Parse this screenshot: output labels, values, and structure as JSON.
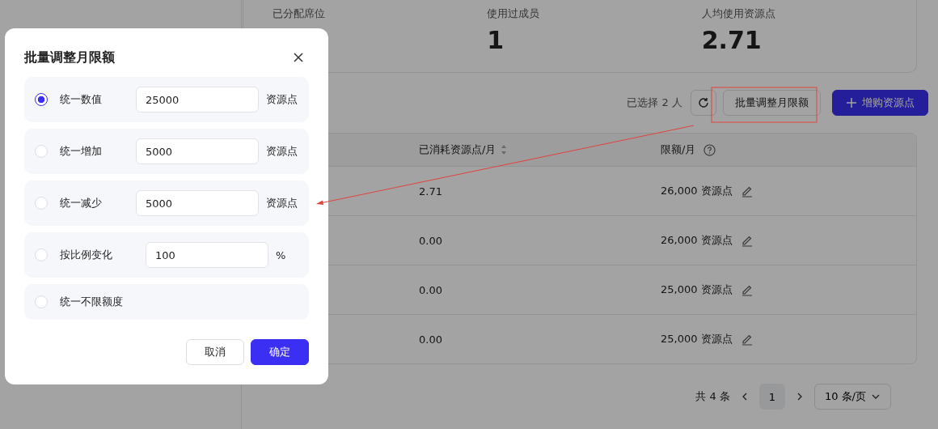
{
  "stats": [
    {
      "label": "已分配席位"
    },
    {
      "label": "使用过成员",
      "value": "1"
    },
    {
      "label": "人均使用资源点",
      "value": "2.71"
    }
  ],
  "toolbar": {
    "selection_text": "已选择 2 人",
    "batch_button": "批量调整月限额",
    "add_button": "增购资源点"
  },
  "table": {
    "columns": [
      "已消耗资源点/月",
      "限额/月"
    ],
    "rows": [
      {
        "consumed": "2.71",
        "limit": "26,000 资源点"
      },
      {
        "consumed": "0.00",
        "limit": "26,000 资源点"
      },
      {
        "consumed": "0.00",
        "limit": "25,000 资源点"
      },
      {
        "consumed": "0.00",
        "limit": "25,000 资源点"
      }
    ]
  },
  "pagination": {
    "total": "共 4 条",
    "page": "1",
    "page_size": "10 条/页"
  },
  "dialog": {
    "title": "批量调整月限额",
    "options": [
      {
        "label": "统一数值",
        "selected": true,
        "value": "25000",
        "unit": "资源点"
      },
      {
        "label": "统一增加",
        "selected": false,
        "value": "5000",
        "unit": "资源点"
      },
      {
        "label": "统一减少",
        "selected": false,
        "value": "5000",
        "unit": "资源点"
      },
      {
        "label": "按比例变化",
        "selected": false,
        "value": "100",
        "unit": "%"
      },
      {
        "label": "统一不限额度",
        "selected": false
      }
    ],
    "cancel": "取消",
    "confirm": "确定"
  }
}
